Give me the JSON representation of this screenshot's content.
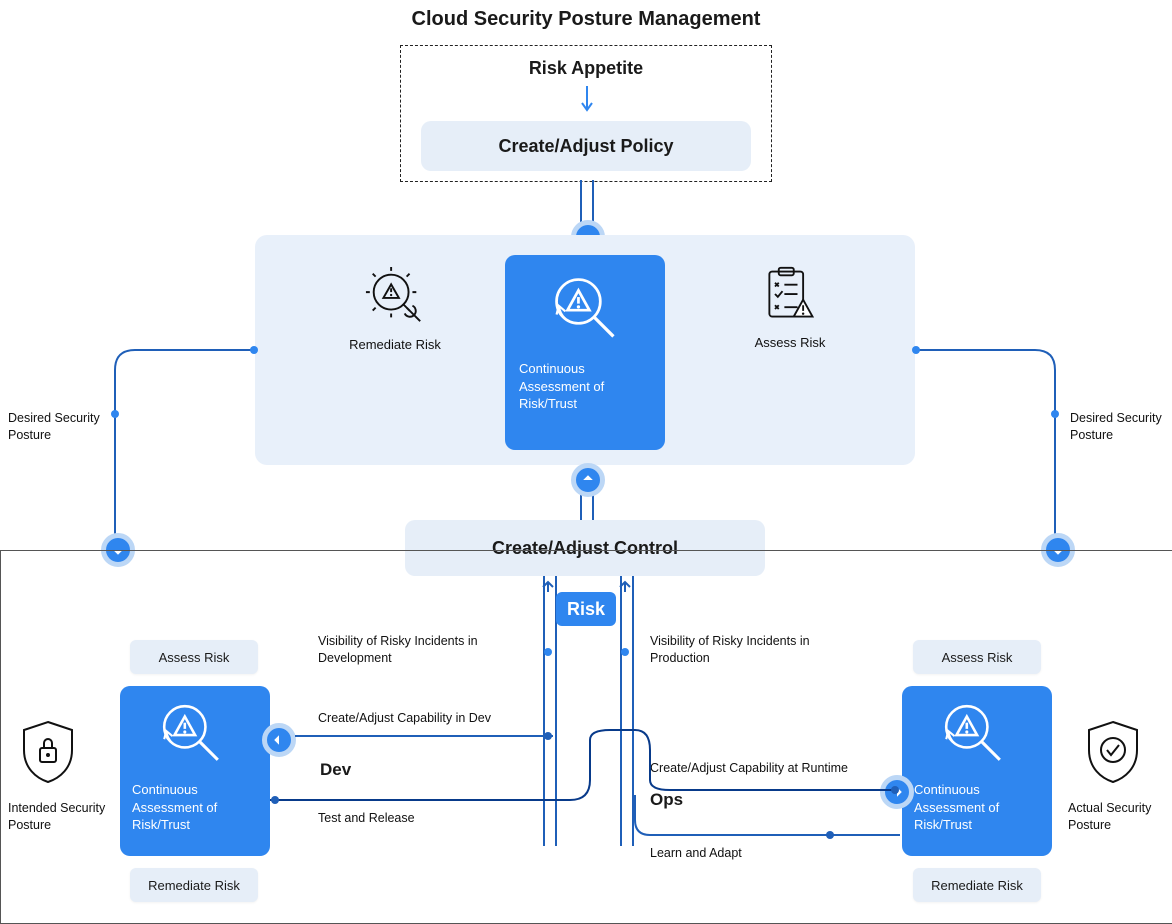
{
  "title": "Cloud Security Posture Management",
  "top": {
    "risk_appetite": "Risk Appetite",
    "create_policy": "Create/Adjust Policy"
  },
  "center_panel": {
    "remediate": "Remediate Risk",
    "continuous": "Continuous Assessment of Risk/Trust",
    "assess": "Assess Risk"
  },
  "control": "Create/Adjust Control",
  "risk_badge": "Risk",
  "side_labels": {
    "desired_left": "Desired Security Posture",
    "desired_right": "Desired Security Posture",
    "intended": "Intended Security Posture",
    "actual": "Actual Security Posture"
  },
  "dev": {
    "assess": "Assess Risk",
    "continuous": "Continuous Assessment of Risk/Trust",
    "remediate": "Remediate Risk",
    "heading": "Dev"
  },
  "ops": {
    "assess": "Assess Risk",
    "continuous": "Continuous Assessment of Risk/Trust",
    "remediate": "Remediate Risk",
    "heading": "Ops"
  },
  "flow_labels": {
    "vis_dev": "Visibility of Risky Incidents in Development",
    "vis_prod": "Visibility of Risky Incidents in Production",
    "cap_dev": "Create/Adjust Capability in Dev",
    "cap_runtime": "Create/Adjust Capability at Runtime",
    "test_release": "Test and Release",
    "learn_adapt": "Learn and Adapt"
  }
}
